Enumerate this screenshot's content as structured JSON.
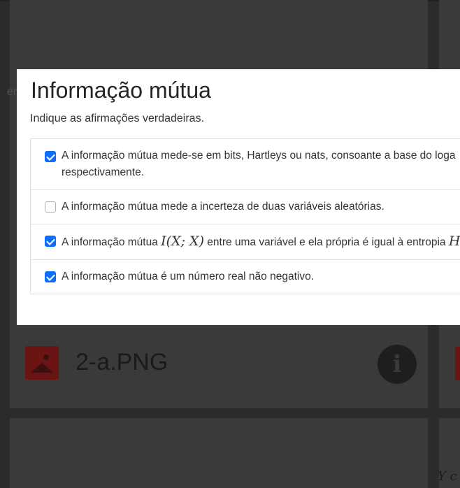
{
  "modal": {
    "title": "Informação mútua",
    "subtitle": "Indique as afirmações verdadeiras.",
    "options": [
      {
        "checked": true,
        "line1": "A informação mútua mede-se em bits, Hartleys ou nats, consoante a base do loga",
        "line2": "respectivamente."
      },
      {
        "checked": false,
        "text": "A informação mútua mede a incerteza de duas variáveis aleatórias."
      },
      {
        "checked": true,
        "before": "A informação mútua ",
        "math": "I(X; X)",
        "after": " entre uma variável e ela própria é igual à entropia ",
        "math2": "H"
      },
      {
        "checked": true,
        "text": "A informação mútua é um número real não negativo."
      }
    ]
  },
  "background": {
    "left_fragment": "er",
    "file_name": "2-a.PNG",
    "info_icon_glyph": "i",
    "bottom_fragment": "Y c",
    "thumb_icon": "image-icon",
    "info_icon": "info-icon"
  },
  "colors": {
    "checkbox_checked": "#0d6efd",
    "overlay": "#2b2b2b",
    "thumb": "#6a1414"
  }
}
